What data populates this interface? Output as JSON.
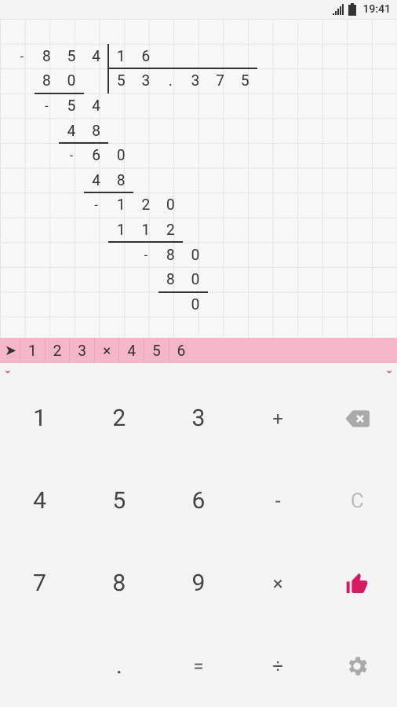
{
  "status": {
    "time": "19:41"
  },
  "worksheet": {
    "cells": [
      {
        "r": 1,
        "c": 0,
        "t": "-",
        "cls": "minus-sign"
      },
      {
        "r": 1,
        "c": 1,
        "t": "8"
      },
      {
        "r": 1,
        "c": 2,
        "t": "5"
      },
      {
        "r": 1,
        "c": 3,
        "t": "4"
      },
      {
        "r": 1,
        "c": 4,
        "t": "1"
      },
      {
        "r": 1,
        "c": 5,
        "t": "6"
      },
      {
        "r": 2,
        "c": 1,
        "t": "8"
      },
      {
        "r": 2,
        "c": 2,
        "t": "0"
      },
      {
        "r": 2,
        "c": 4,
        "t": "5"
      },
      {
        "r": 2,
        "c": 5,
        "t": "3"
      },
      {
        "r": 2,
        "c": 6,
        "t": "."
      },
      {
        "r": 2,
        "c": 7,
        "t": "3"
      },
      {
        "r": 2,
        "c": 8,
        "t": "7"
      },
      {
        "r": 2,
        "c": 9,
        "t": "5"
      },
      {
        "r": 3,
        "c": 1,
        "t": "-",
        "cls": "minus-sign"
      },
      {
        "r": 3,
        "c": 2,
        "t": "5"
      },
      {
        "r": 3,
        "c": 3,
        "t": "4"
      },
      {
        "r": 4,
        "c": 2,
        "t": "4"
      },
      {
        "r": 4,
        "c": 3,
        "t": "8"
      },
      {
        "r": 5,
        "c": 2,
        "t": "-",
        "cls": "minus-sign"
      },
      {
        "r": 5,
        "c": 3,
        "t": "6"
      },
      {
        "r": 5,
        "c": 4,
        "t": "0"
      },
      {
        "r": 6,
        "c": 3,
        "t": "4"
      },
      {
        "r": 6,
        "c": 4,
        "t": "8"
      },
      {
        "r": 7,
        "c": 3,
        "t": "-",
        "cls": "minus-sign"
      },
      {
        "r": 7,
        "c": 4,
        "t": "1"
      },
      {
        "r": 7,
        "c": 5,
        "t": "2"
      },
      {
        "r": 7,
        "c": 6,
        "t": "0"
      },
      {
        "r": 8,
        "c": 4,
        "t": "1"
      },
      {
        "r": 8,
        "c": 5,
        "t": "1"
      },
      {
        "r": 8,
        "c": 6,
        "t": "2"
      },
      {
        "r": 9,
        "c": 5,
        "t": "-",
        "cls": "minus-sign"
      },
      {
        "r": 9,
        "c": 6,
        "t": "8"
      },
      {
        "r": 9,
        "c": 7,
        "t": "0"
      },
      {
        "r": 10,
        "c": 6,
        "t": "8"
      },
      {
        "r": 10,
        "c": 7,
        "t": "0"
      },
      {
        "r": 11,
        "c": 7,
        "t": "0"
      }
    ],
    "hlines": [
      {
        "r": 3,
        "c1": 1,
        "c2": 3
      },
      {
        "r": 2,
        "c1": 4,
        "c2": 10
      },
      {
        "r": 5,
        "c1": 2,
        "c2": 4
      },
      {
        "r": 7,
        "c1": 3,
        "c2": 5
      },
      {
        "r": 9,
        "c1": 4,
        "c2": 7
      },
      {
        "r": 11,
        "c1": 6,
        "c2": 8
      }
    ],
    "vlines": [
      {
        "c": 4,
        "r1": 1,
        "r2": 3
      }
    ]
  },
  "input": {
    "prompt": "➤",
    "chars": [
      "1",
      "2",
      "3",
      "×",
      "4",
      "5",
      "6"
    ]
  },
  "keypad": {
    "keys": [
      {
        "label": "1",
        "type": "num"
      },
      {
        "label": "2",
        "type": "num"
      },
      {
        "label": "3",
        "type": "num"
      },
      {
        "label": "+",
        "type": "op"
      },
      {
        "label": "",
        "type": "backspace"
      },
      {
        "label": "4",
        "type": "num"
      },
      {
        "label": "5",
        "type": "num"
      },
      {
        "label": "6",
        "type": "num"
      },
      {
        "label": "-",
        "type": "op"
      },
      {
        "label": "C",
        "type": "clear"
      },
      {
        "label": "7",
        "type": "num"
      },
      {
        "label": "8",
        "type": "num"
      },
      {
        "label": "9",
        "type": "num"
      },
      {
        "label": "×",
        "type": "op"
      },
      {
        "label": "",
        "type": "thumbs"
      },
      {
        "label": "",
        "type": "blank"
      },
      {
        "label": ".",
        "type": "num"
      },
      {
        "label": "=",
        "type": "op"
      },
      {
        "label": "÷",
        "type": "op"
      },
      {
        "label": "",
        "type": "gear"
      }
    ]
  }
}
